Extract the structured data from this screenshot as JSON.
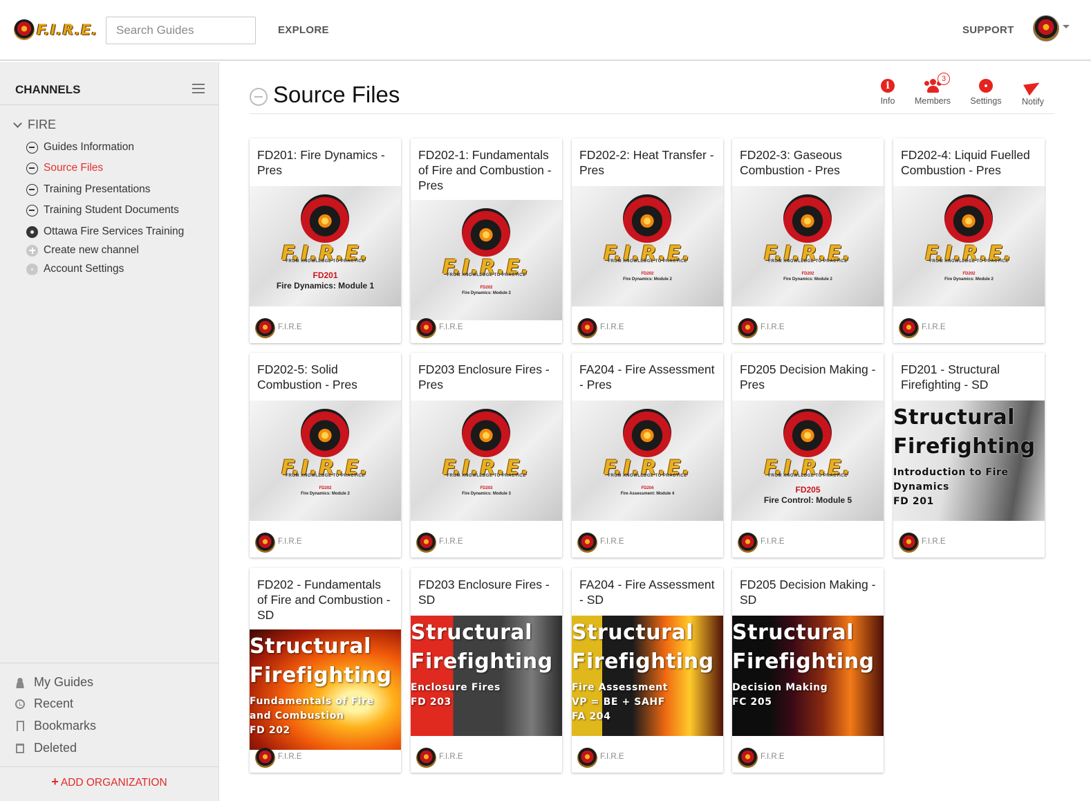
{
  "app": {
    "logo_text": "F.I.R.E.",
    "logo_tagline": "FROM KNOWLEDGE TO PRACTICE",
    "search_placeholder": "Search Guides",
    "nav_explore": "EXPLORE",
    "nav_support": "SUPPORT",
    "brand_color": "#e52420"
  },
  "sidebar": {
    "title": "CHANNELS",
    "group": "FIRE",
    "items": [
      {
        "label": "Guides Information",
        "icon": "minus-circle-icon",
        "active": false
      },
      {
        "label": "Source Files",
        "icon": "minus-circle-icon",
        "active": true
      },
      {
        "label": "Training Presentations",
        "icon": "minus-circle-icon",
        "active": false
      },
      {
        "label": "Training Student Documents",
        "icon": "minus-circle-icon",
        "active": false
      },
      {
        "label": "Ottawa Fire Services Training",
        "icon": "group-icon",
        "active": false
      },
      {
        "label": "Create new channel",
        "icon": "plus-circle-icon",
        "active": false
      },
      {
        "label": "Account Settings",
        "icon": "gear-icon",
        "active": false
      }
    ],
    "quick_links": [
      {
        "label": "My Guides",
        "icon": "user-icon"
      },
      {
        "label": "Recent",
        "icon": "clock-icon"
      },
      {
        "label": "Bookmarks",
        "icon": "bookmark-icon"
      },
      {
        "label": "Deleted",
        "icon": "trash-icon"
      }
    ],
    "add_org": "ADD ORGANIZATION"
  },
  "page": {
    "title": "Source Files",
    "tools": {
      "info": "Info",
      "members": "Members",
      "members_badge": "3",
      "settings": "Settings",
      "notify": "Notify"
    }
  },
  "cards": [
    {
      "title": "FD201: Fire Dynamics - Pres",
      "owner": "F.I.R.E",
      "cover": {
        "type": "logo",
        "code": "FD201",
        "module": "Fire Dynamics: Module 1",
        "size": "big"
      }
    },
    {
      "title": "FD202-1: Fundamentals of Fire and Combustion - Pres",
      "owner": "F.I.R.E",
      "cover": {
        "type": "logo",
        "code": "FD202",
        "module": "Fire Dynamics: Module 2",
        "size": "small"
      }
    },
    {
      "title": "FD202-2: Heat Transfer - Pres",
      "owner": "F.I.R.E",
      "cover": {
        "type": "logo",
        "code": "FD202",
        "module": "Fire Dynamics: Module 2",
        "size": "small"
      }
    },
    {
      "title": "FD202-3: Gaseous Combustion - Pres",
      "owner": "F.I.R.E",
      "cover": {
        "type": "logo",
        "code": "FD202",
        "module": "Fire Dynamics: Module 2",
        "size": "small"
      }
    },
    {
      "title": "FD202-4: Liquid Fuelled Combustion - Pres",
      "owner": "F.I.R.E",
      "cover": {
        "type": "logo",
        "code": "FD202",
        "module": "Fire Dynamics: Module 2",
        "size": "small"
      }
    },
    {
      "title": "FD202-5: Solid Combustion - Pres",
      "owner": "F.I.R.E",
      "cover": {
        "type": "logo",
        "code": "FD202",
        "module": "Fire Dynamics: Module 2",
        "size": "small"
      }
    },
    {
      "title": "FD203 Enclosure Fires - Pres",
      "owner": "F.I.R.E",
      "cover": {
        "type": "logo",
        "code": "FD203",
        "module": "Fire Dynamics: Module 3",
        "size": "small"
      }
    },
    {
      "title": "FA204 - Fire Assessment - Pres",
      "owner": "F.I.R.E",
      "cover": {
        "type": "logo",
        "code": "FD204",
        "module": "Fire Assessment: Module 4",
        "size": "small"
      }
    },
    {
      "title": "FD205 Decision Making - Pres",
      "owner": "F.I.R.E",
      "cover": {
        "type": "logo",
        "code": "FD205",
        "module": "Fire Control: Module 5",
        "size": "big"
      }
    },
    {
      "title": "FD201 - Structural Firefighting - SD",
      "owner": "F.I.R.E",
      "cover": {
        "type": "sf",
        "style": "sf-white",
        "heading": "Structural\nFirefighting",
        "sub": "Introduction to Fire\nDynamics\nFD 201"
      }
    },
    {
      "title": "FD202 - Fundamentals of Fire and Combustion - SD",
      "owner": "F.I.R.E",
      "cover": {
        "type": "sf",
        "style": "sf-fire1",
        "heading": "Structural\nFirefighting",
        "sub": "Fundamentals of Fire\nand Combustion\nFD 202"
      }
    },
    {
      "title": "FD203 Enclosure Fires - SD",
      "owner": "F.I.R.E",
      "cover": {
        "type": "sf",
        "style": "sf-smoke",
        "heading": "Structural\nFirefighting",
        "sub": "Enclosure Fires\nFD 203"
      }
    },
    {
      "title": "FA204 - Fire Assessment - SD",
      "owner": "F.I.R.E",
      "cover": {
        "type": "sf",
        "style": "sf-yellow",
        "heading": "Structural\nFirefighting",
        "sub": "Fire Assessment\nVP = BE + SAHF\nFA 204"
      }
    },
    {
      "title": "FD205 Decision Making - SD",
      "owner": "F.I.R.E",
      "cover": {
        "type": "sf",
        "style": "sf-dark",
        "heading": "Structural\nFirefighting",
        "sub": "Decision Making\nFC 205"
      }
    }
  ]
}
